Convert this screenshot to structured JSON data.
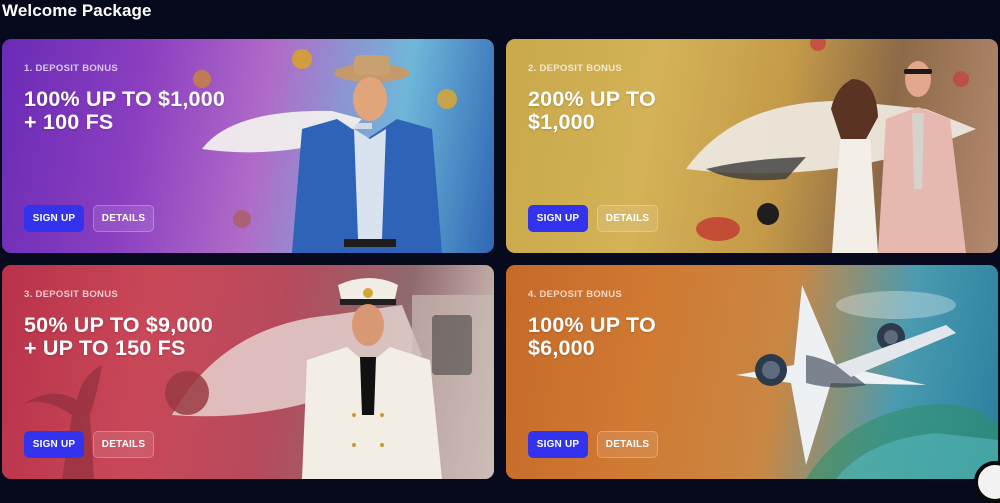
{
  "page": {
    "title": "Welcome Package"
  },
  "cards": [
    {
      "label": "1. DEPOSIT BONUS",
      "line1": "100% UP TO $1,000",
      "line2": "+ 100 FS",
      "signup": "SIGN UP",
      "details": "DETAILS"
    },
    {
      "label": "2. DEPOSIT BONUS",
      "line1": "200% UP TO",
      "line2": "$1,000",
      "signup": "SIGN UP",
      "details": "DETAILS"
    },
    {
      "label": "3. DEPOSIT BONUS",
      "line1": "50% UP TO $9,000",
      "line2": "+ UP TO 150 FS",
      "signup": "SIGN UP",
      "details": "DETAILS"
    },
    {
      "label": "4. DEPOSIT BONUS",
      "line1": "100% UP TO",
      "line2": "$6,000",
      "signup": "SIGN UP",
      "details": "DETAILS"
    }
  ],
  "colors": {
    "background": "#070a1c",
    "signup_button": "#3333ee"
  },
  "icons": {
    "corner": "chat-launcher-icon"
  }
}
